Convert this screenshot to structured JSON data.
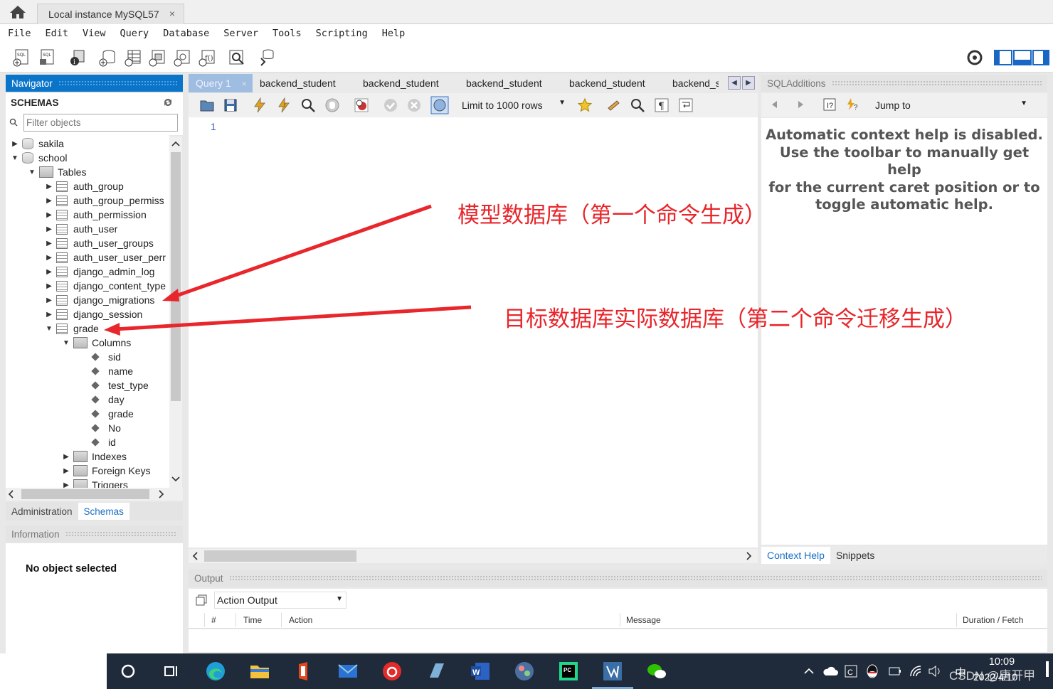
{
  "window_tab": {
    "title": "Local instance MySQL57",
    "close": "×"
  },
  "menu": [
    "File",
    "Edit",
    "View",
    "Query",
    "Database",
    "Server",
    "Tools",
    "Scripting",
    "Help"
  ],
  "navigator": {
    "header": "Navigator",
    "schemas_label": "SCHEMAS",
    "filter_placeholder": "Filter objects",
    "tree": {
      "sakila": "sakila",
      "school": "school",
      "tables": "Tables",
      "table_items": [
        "auth_group",
        "auth_group_permiss",
        "auth_permission",
        "auth_user",
        "auth_user_groups",
        "auth_user_user_perr",
        "django_admin_log",
        "django_content_type",
        "django_migrations",
        "django_session",
        "grade"
      ],
      "columns_label": "Columns",
      "columns": [
        "sid",
        "name",
        "test_type",
        "day",
        "grade",
        "No",
        "id"
      ],
      "indexes": "Indexes",
      "foreign_keys": "Foreign Keys",
      "triggers": "Triggers"
    },
    "bottom_tabs": [
      "Administration",
      "Schemas"
    ],
    "information_header": "Information",
    "no_object": "No object selected"
  },
  "query_tabs": [
    "Query 1",
    "backend_student",
    "backend_student",
    "backend_student",
    "backend_student",
    "backend_s"
  ],
  "query_toolbar": {
    "limit": "Limit to 1000 rows"
  },
  "editor": {
    "line_number": "1"
  },
  "sql_additions": {
    "header": "SQLAdditions",
    "jump_to": "Jump to",
    "help_lines": [
      "Automatic context help is disabled.",
      "Use the toolbar to manually get help",
      "for the current caret position or to",
      "toggle automatic help."
    ],
    "tabs": [
      "Context Help",
      "Snippets"
    ]
  },
  "output": {
    "header": "Output",
    "selector": "Action Output",
    "columns": [
      "#",
      "Time",
      "Action",
      "Message",
      "Duration / Fetch"
    ]
  },
  "annotations": {
    "first": "模型数据库（第一个命令生成）",
    "second": "目标数据库实际数据库（第二个命令迁移生成）",
    "color": "#e8262b"
  },
  "taskbar": {
    "time": "10:09",
    "date": "2022/4/10",
    "watermark": "CSDN @唐开甲",
    "ime": "中"
  }
}
